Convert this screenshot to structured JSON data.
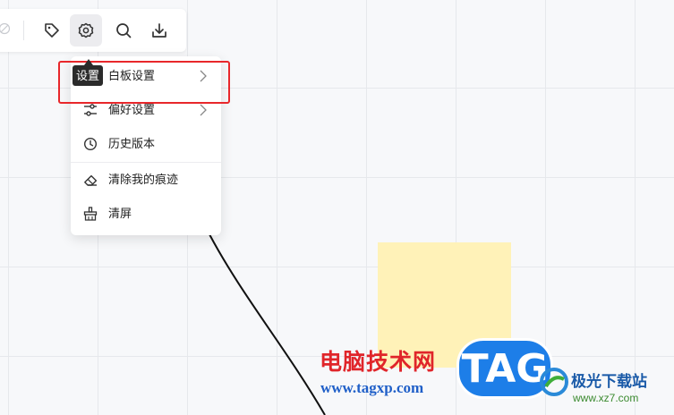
{
  "toolbar": {
    "buttons": [
      {
        "icon": "tag-icon",
        "label": ""
      },
      {
        "icon": "gear-icon",
        "label": ""
      },
      {
        "icon": "search-icon",
        "label": ""
      },
      {
        "icon": "download-icon",
        "label": ""
      }
    ],
    "active_button": "gear-icon"
  },
  "tooltip": {
    "text": "设置"
  },
  "settings_menu": {
    "items": [
      {
        "label": "白板设置",
        "icon": "whiteboard-icon",
        "has_submenu": true
      },
      {
        "label": "偏好设置",
        "icon": "sliders-icon",
        "has_submenu": true
      },
      {
        "label": "历史版本",
        "icon": "clock-icon",
        "has_submenu": false
      },
      {
        "label": "清除我的痕迹",
        "icon": "eraser-icon",
        "has_submenu": false
      },
      {
        "label": "清屏",
        "icon": "broom-icon",
        "has_submenu": false
      }
    ]
  },
  "watermark": {
    "site_name_cn": "电脑技术网",
    "site_url": "www.tagxp.com",
    "badge": "TAG",
    "site2_name": "极光下载站",
    "site2_url": "www.xz7.com"
  },
  "colors": {
    "highlight_border": "#e8272b",
    "sticky_note": "#fff2b8",
    "canvas_bg": "#f7f8fa"
  }
}
